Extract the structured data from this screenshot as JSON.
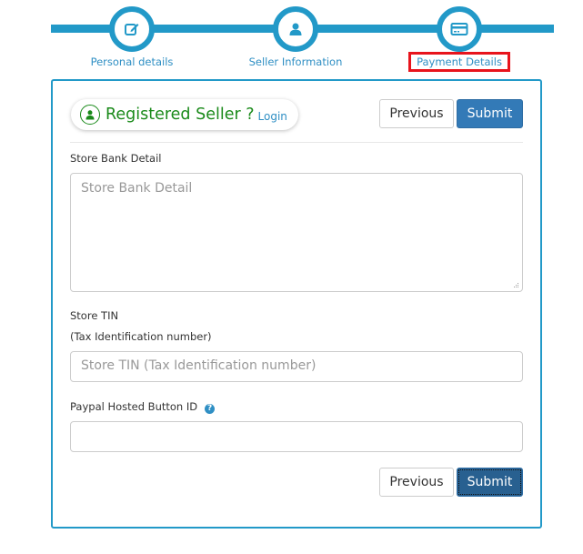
{
  "stepper": {
    "steps": [
      {
        "label": "Personal details",
        "icon": "edit-icon",
        "active": false
      },
      {
        "label": "Seller Information",
        "icon": "user-icon",
        "active": false
      },
      {
        "label": "Payment Details",
        "icon": "credit-card-icon",
        "active": true
      }
    ]
  },
  "header": {
    "registered_text": "Registered Seller ?",
    "login_link": "Login",
    "previous_label": "Previous",
    "submit_label": "Submit"
  },
  "form": {
    "bank_detail": {
      "label": "Store Bank Detail",
      "placeholder": "Store Bank Detail",
      "value": ""
    },
    "tin": {
      "label": "Store TIN",
      "sublabel": "(Tax Identification number)",
      "placeholder": "Store TIN (Tax Identification number)",
      "value": ""
    },
    "paypal": {
      "label": "Paypal Hosted Button ID",
      "help_icon": "?",
      "placeholder": "",
      "value": ""
    }
  },
  "footer": {
    "previous_label": "Previous",
    "submit_label": "Submit"
  },
  "colors": {
    "accent": "#2299c8",
    "primary_button": "#337ab7",
    "success_green": "#1a8a1a",
    "highlight_red": "#e8141c"
  }
}
